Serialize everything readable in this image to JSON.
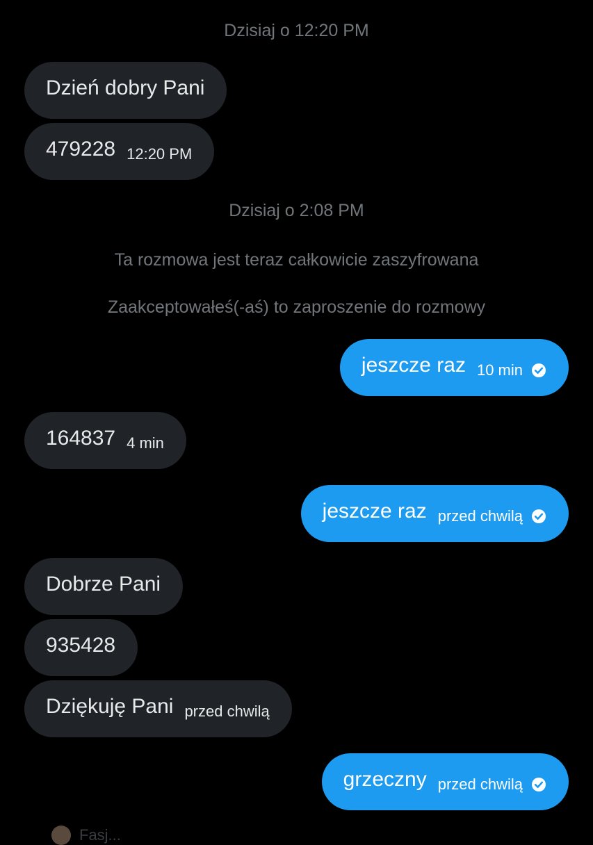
{
  "timestamps": {
    "first": "Dzisiaj o 12:20 PM",
    "second": "Dzisiaj o 2:08 PM"
  },
  "system_notices": {
    "encrypted": "Ta rozmowa jest teraz całkowicie zaszyfrowana",
    "accepted": "Zaakceptowałeś(-aś) to zaproszenie do rozmowy"
  },
  "messages": [
    {
      "direction": "incoming",
      "text": "Dzień dobry Pani",
      "time": ""
    },
    {
      "direction": "incoming",
      "text": "479228",
      "time": "12:20 PM"
    },
    {
      "direction": "outgoing",
      "text": "jeszcze raz",
      "time": "10 min",
      "status": "read"
    },
    {
      "direction": "incoming",
      "text": "164837",
      "time": "4 min"
    },
    {
      "direction": "outgoing",
      "text": "jeszcze raz",
      "time": "przed chwilą",
      "status": "read"
    },
    {
      "direction": "incoming",
      "text": "Dobrze Pani",
      "time": ""
    },
    {
      "direction": "incoming",
      "text": "935428",
      "time": ""
    },
    {
      "direction": "incoming",
      "text": "Dziękuję Pani",
      "time": "przed chwilą"
    },
    {
      "direction": "outgoing",
      "text": "grzeczny",
      "time": "przed chwilą",
      "status": "read"
    }
  ],
  "bottom_partial": {
    "label": "Fasj..."
  },
  "colors": {
    "background": "#000000",
    "incoming_bubble": "#202327",
    "outgoing_bubble": "#1d9bf0",
    "system_text": "#71767b"
  },
  "icons": {
    "read_receipt": "check-circle-icon"
  }
}
